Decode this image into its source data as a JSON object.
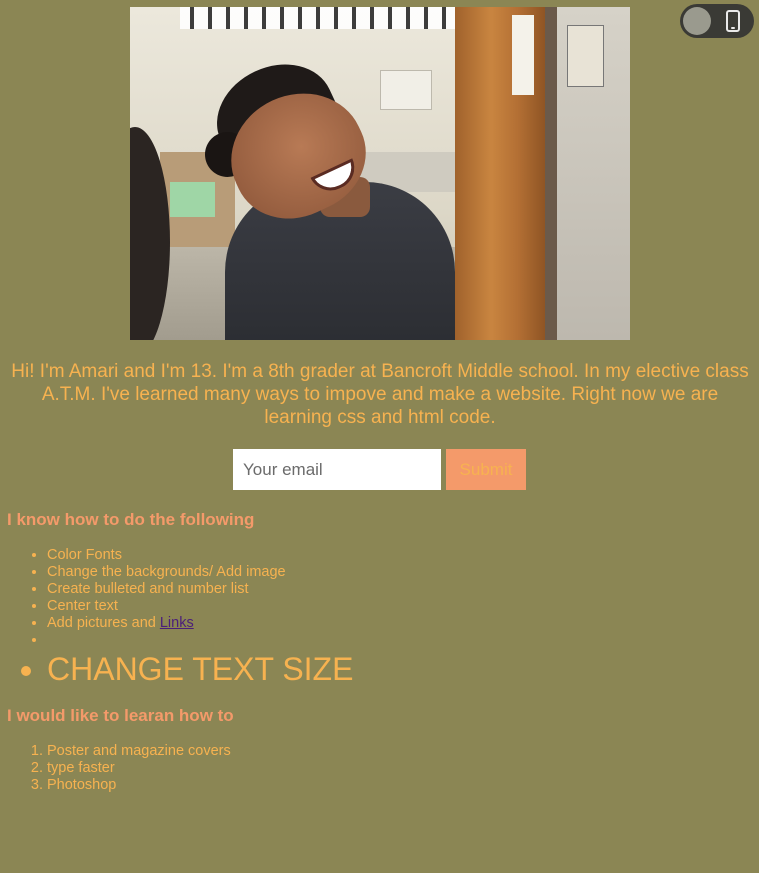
{
  "toggle": {
    "icon": "phone-icon",
    "state": "off"
  },
  "photo": {
    "description_icon": "profile-photo"
  },
  "intro": "Hi! I'm Amari and I'm 13. I'm a 8th grader at Bancroft Middle school. In my elective class A.T.M. I've learned many ways to impove and make a website. Right now we are learning css and html code.",
  "form": {
    "email_placeholder": "Your email",
    "submit_label": "Submit"
  },
  "skills": {
    "heading": "I know how to do the following",
    "items": [
      "Color Fonts",
      "Change the backgrounds/ Add image",
      "Create bulleted and number list",
      "Center text"
    ],
    "pictures_text": "Add pictures and ",
    "links_text": "Links",
    "big_item": "CHANGE TEXT SIZE"
  },
  "goals": {
    "heading": "I would like to learan how to",
    "items": [
      "Poster and magazine covers",
      "type faster",
      "Photoshop"
    ]
  },
  "colors": {
    "background": "#8b8654",
    "text": "#f7b250",
    "heading": "#f49a6a",
    "button": "#f49a6a",
    "link": "#4b1f7a"
  }
}
